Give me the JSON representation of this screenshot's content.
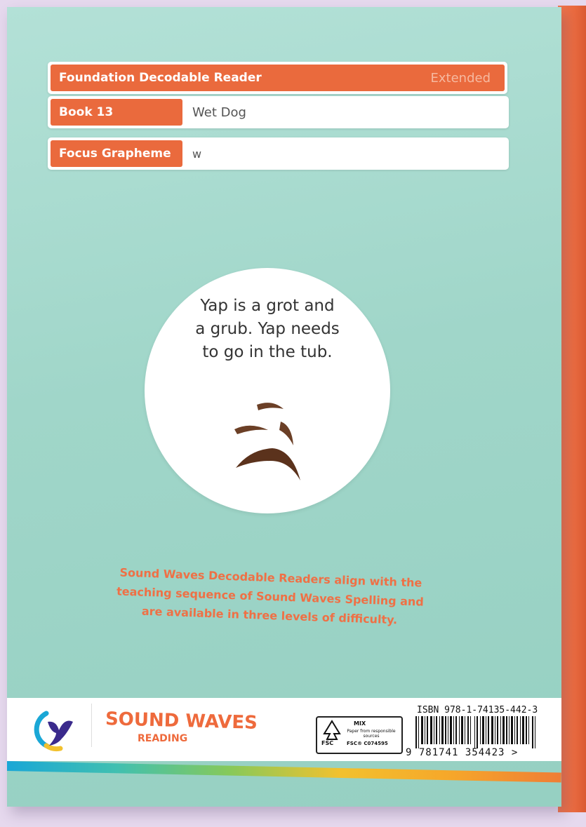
{
  "header": {
    "series_label": "Foundation Decodable Reader",
    "level_label": "Extended",
    "book_label": "Book 13",
    "book_title": "Wet Dog",
    "focus_label": "Focus Grapheme",
    "focus_value": "w"
  },
  "blurb": {
    "lines": [
      "Yap is a grot and",
      "a grub. Yap needs",
      "to go in the tub."
    ]
  },
  "tagline": {
    "lines": [
      "Sound Waves Decodable Readers align with the",
      "teaching sequence of Sound Waves Spelling and",
      "are available in three levels of difficulty."
    ]
  },
  "brand": {
    "name": "SOUND WAVES",
    "subtitle": "READING"
  },
  "fsc": {
    "mix": "MIX",
    "paper": "Paper from responsible sources",
    "label": "FSC",
    "code": "FSC® C074595"
  },
  "barcode": {
    "isbn": "ISBN 978-1-74135-442-3",
    "digits": "9 781741 354423 >"
  },
  "colors": {
    "cover": "#a0d6c9",
    "accent": "#ea6a3d",
    "spine": "#ea6a3f",
    "background": "#e6d9ee"
  },
  "icons": {
    "logo": "publisher-logo-icon",
    "fsc": "fsc-tree-icon",
    "barcode": "barcode-icon",
    "illustration": "mud-splash-icon"
  }
}
